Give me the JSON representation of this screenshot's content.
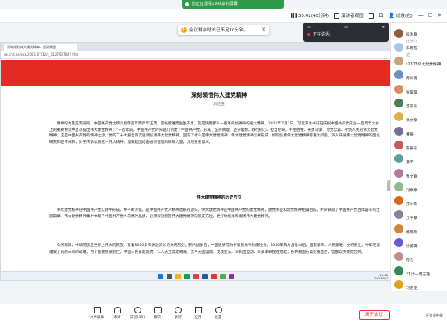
{
  "banner": {
    "text": "您正在观看XX共享的屏幕"
  },
  "topbar": {
    "duration": "30:42(40分钟)",
    "speaker_view": "演讲者视图",
    "user": "成俊(它)"
  },
  "toast": {
    "text": "会议剩余时长已不足10分钟。"
  },
  "mini_panel": {
    "status": "正在讲话:"
  },
  "browser": {
    "tab_title": "深刻领悟伟大建党精神 - 党建频道",
    "address": "xx.cn/xxx/xxx/2021-07/12/c_1127637847.htm"
  },
  "document": {
    "title": "深刻领悟伟大建党精神",
    "author": "周佳玉",
    "paragraphs": [
      "精神的力量是无穷的。中国共产党之所以能够百年而风华正茂，饱经磨难而生生不息，就是凭着那么一股革命加拼命的强大精神。2021年7月1日，习近平总书记在庆祝中国共产党成立一百周年大会上的重要讲话中首次提出伟大建党精神：“一百年前，中国共产党的先驱们创建了中国共产党，形成了坚持真理、坚守理想，践行初心、担当使命，不怕牺牲、英勇斗争，对党忠诚、不负人民的伟大建党精神，这是中国共产党的精神之源。”党的二十大报告再次强调弘扬伟大建党精神，回答了什么是伟大建党精神、伟大建党精神怎样形成、如何弘扬伟大建党精神等重大问题，深入开展伟大建党精神的理论研究和宣传阐释，对于传承弘扬这一伟大精神，凝聚起团结奋进新征程的磅礴力量，具有重要意义。"
    ],
    "section_heading": "伟大建党精神的历史方位",
    "paragraphs2": [
      "伟大建党精神在中国共产党实践中形成，并不断深化，是中国共产党人精神谱系的源头。伟大建党精神是中国共产党的建党精神，建党伟业和建党精神相辅相成，共同铸就了中国共产党百年奋斗的壮丽篇章。伟大建党精神集中体现了中国共产党人的精神品质，必须深刻把握伟大建党精神的历史方位，更好地继承和发扬伟大建党精神。",
      "众所周知，中华民族是世界上伟大的民族，有着5000多年源远流长的文明历史。鸦片战争后，中国逐步成为半殖民地半封建社会。1840年鸦片战争以后，国家蒙辱、人民蒙难、文明蒙尘，中华民族遭受了前所未有的劫难。为了拯救民族危亡，中国人民奋起反抗，仁人志士奔走呐喊，太平天国运动、戊戌变法、义和团运动、辛亥革命接连而起，各种救国方案轮番出台，但都以失败而告终。"
    ]
  },
  "participants": [
    {
      "name": "段冰静",
      "sub": "(主持人)"
    },
    {
      "name": "朱晓钰",
      "sub": "(它)"
    },
    {
      "name": "s2813伟大建党精神",
      "sub": ""
    },
    {
      "name": "周川雨",
      "sub": ""
    },
    {
      "name": "张阳阳",
      "sub": ""
    },
    {
      "name": "苏家乐",
      "sub": ""
    },
    {
      "name": "徐文静",
      "sub": ""
    },
    {
      "name": "黄振",
      "sub": ""
    },
    {
      "name": "陈振东",
      "sub": ""
    },
    {
      "name": "潘宇",
      "sub": ""
    },
    {
      "name": "鲁文静",
      "sub": ""
    },
    {
      "name": "刘婷婷",
      "sub": ""
    },
    {
      "name": "苏小玲",
      "sub": ""
    },
    {
      "name": "万平静",
      "sub": ""
    },
    {
      "name": "杨晓玲",
      "sub": ""
    },
    {
      "name": "孙美琪",
      "sub": ""
    },
    {
      "name": "周艺",
      "sub": ""
    },
    {
      "name": "21计一周志雄",
      "sub": ""
    },
    {
      "name": "刘佳佳",
      "sub": ""
    }
  ],
  "toolbar": {
    "items": [
      "共享屏幕",
      "邀请",
      "成员(19)",
      "聊天",
      "录制",
      "应用",
      "设置"
    ],
    "leave": "离开会议",
    "hint": "任务全中碎"
  },
  "taskbar": {
    "time": "16:48",
    "date": "2023/5/7"
  },
  "colors": {
    "accent": "#2f9b49",
    "brand_red": "#e32b23",
    "leave": "#ee3333"
  }
}
